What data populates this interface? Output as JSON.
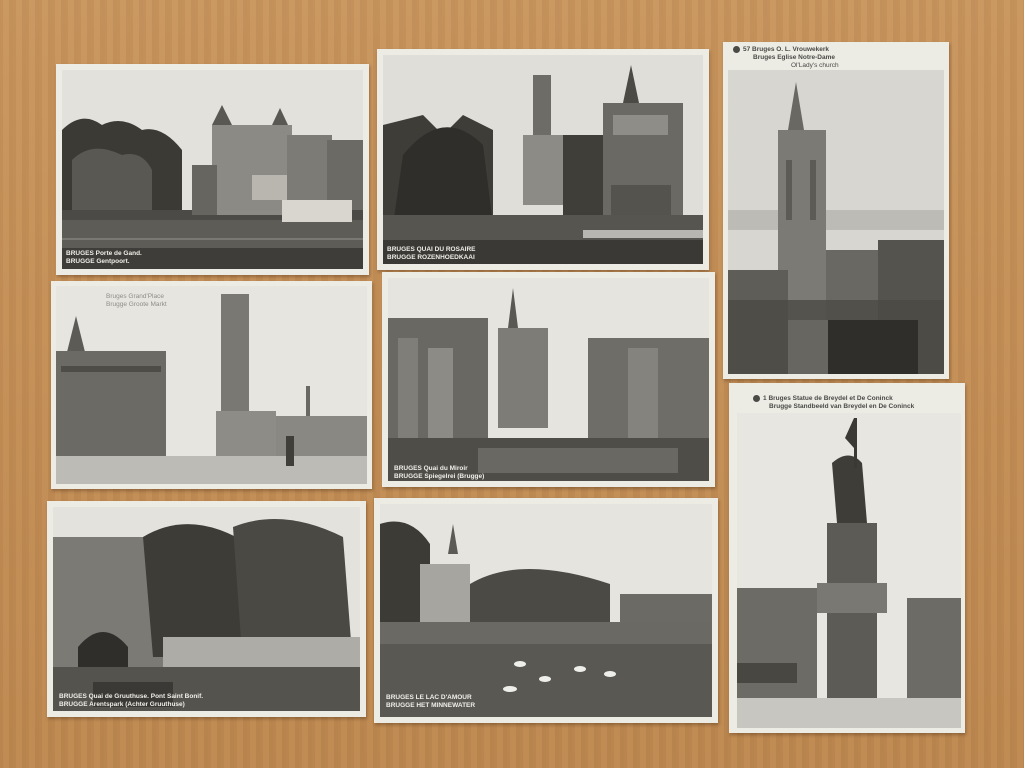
{
  "postcards": [
    {
      "line1": "BRUGES  Porte de Gand.",
      "line2": "BRUGGE  Gentpoort."
    },
    {
      "line1": "BRUGES  QUAI DU ROSAIRE",
      "line2": "BRUGGE  ROZENHOEDKAAI"
    },
    {
      "num": "57",
      "line1": "Bruges  O. L. Vrouwekerk",
      "line2": "Bruges  Eglise Notre-Dame",
      "line3": "Ol'Lady's church"
    },
    {
      "line1": "Bruges   Grand'Place",
      "line2": "Brugge   Groote Markt"
    },
    {
      "line1": "BRUGES  Quai du Miroir",
      "line2": "BRUGGE  Spiegelrei (Brugge)"
    },
    {
      "num": "1",
      "line1": "Bruges  Statue de Breydel  et De Coninck",
      "line2": "Brugge  Standbeeld van  Breydel en De Coninck"
    },
    {
      "line1": "BRUGES  Quai de Gruuthuse. Pont Saint Bonif.",
      "line2": "BRUGGE  Arentspark (Achter Gruuthuse)"
    },
    {
      "line1": "BRUGES  LE LAC D'AMOUR",
      "line2": "BRUGGE  HET MINNEWATER"
    }
  ],
  "colors": {
    "table": "#c48f57",
    "card": "#ecebe4",
    "sepia_dark": "#3c3a34",
    "sepia_mid": "#8a8780",
    "sky": "#dedcd6"
  }
}
